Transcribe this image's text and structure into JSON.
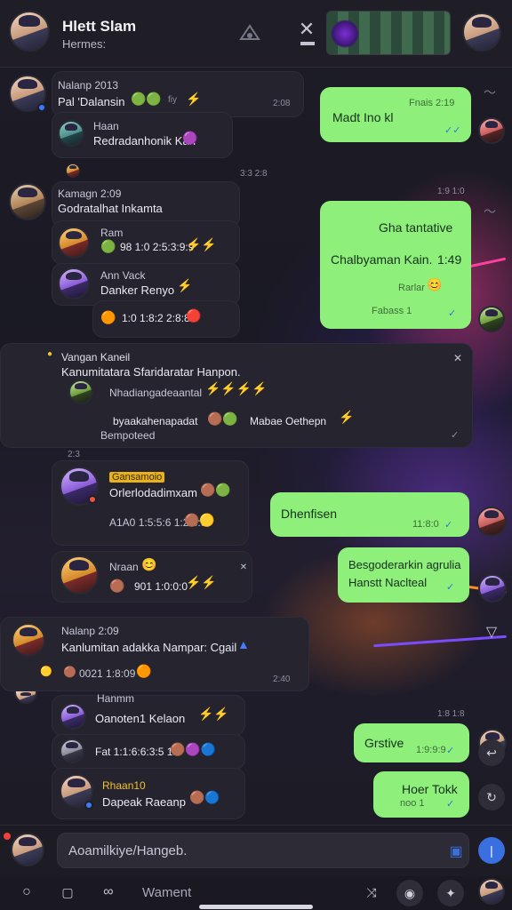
{
  "header": {
    "title": "Hlett Slam",
    "subtitle": "Hermes:"
  },
  "messages": [
    {
      "name": "Nalanp 2013",
      "text": "Pal 'Dalansin",
      "emoji_tail": "fiy",
      "time": "2:08"
    },
    {
      "name": "Haan",
      "text": "Redradanhonik Kan"
    },
    {
      "time_center": "3:3 2:8"
    },
    {
      "name": "Kamagn 2:09",
      "text": "Godratalhat Inkamta",
      "time": "1:9 1:0"
    },
    {
      "name": "Ram",
      "text": "98 1:0 2:5:3:9:9"
    },
    {
      "name": "Ann Vack",
      "text": "Danker Renyo"
    },
    {
      "text": "1:0 1:8:2 2:8:8:9"
    },
    {
      "name": "Vangan Kaneil",
      "text": "Kanumitatara Sfaridaratar Hanpon."
    },
    {
      "text": "Nhadiangadeaantal"
    },
    {
      "text": "byaakahenapadat",
      "text2": "Mabae Oethepn",
      "text3": "Bempoteed"
    },
    {
      "tag": "Gansamoio",
      "text": "Orlerlodadimxam"
    },
    {
      "text": "A1A0 1:5:5:6 1:2:8:9"
    },
    {
      "name": "Nraan",
      "text": "901 1:0:0:0"
    },
    {
      "name": "Nalanp 2:09",
      "text": "Kanlumitan adakka Nampar: Cgail",
      "time": "2:40"
    },
    {
      "text": "0021 1:8:09"
    },
    {
      "name": "Hanmm",
      "text": "Oanoten1 Kelaon"
    },
    {
      "text": "Fat 1:1:6:6:3:5 1:0"
    },
    {
      "name": "Rhaan10",
      "text": "Dapeak Raeanp"
    }
  ],
  "out_messages": [
    {
      "text": "Madt Ino kl",
      "time": "Fnais 2:19"
    },
    {
      "text": "Gha tantative",
      "text2": "Chalbyaman Kain.",
      "text2b": "1:49",
      "text3": "Rarlar",
      "text4": "Fabass 1"
    },
    {
      "text": "Dhenfisen",
      "time": "11:8:0"
    },
    {
      "text": "Besgoderarkin agrulia",
      "text2": "Hanstt Naclteal"
    },
    {
      "text": "Grstive",
      "time": "1:9:9:9"
    },
    {
      "text": "Hoer Tokk",
      "time": "noo 1"
    }
  ],
  "composer": {
    "placeholder": "Aoamilkiye/Hangeb."
  },
  "bottom": {
    "label": "Wament"
  },
  "times": {
    "t1": "3:3 2:8",
    "t2": "1:9 1:0",
    "t3": "2:3",
    "t4": "1:8 1:8"
  },
  "icons": {
    "close": "close-icon",
    "send": "send-icon"
  }
}
